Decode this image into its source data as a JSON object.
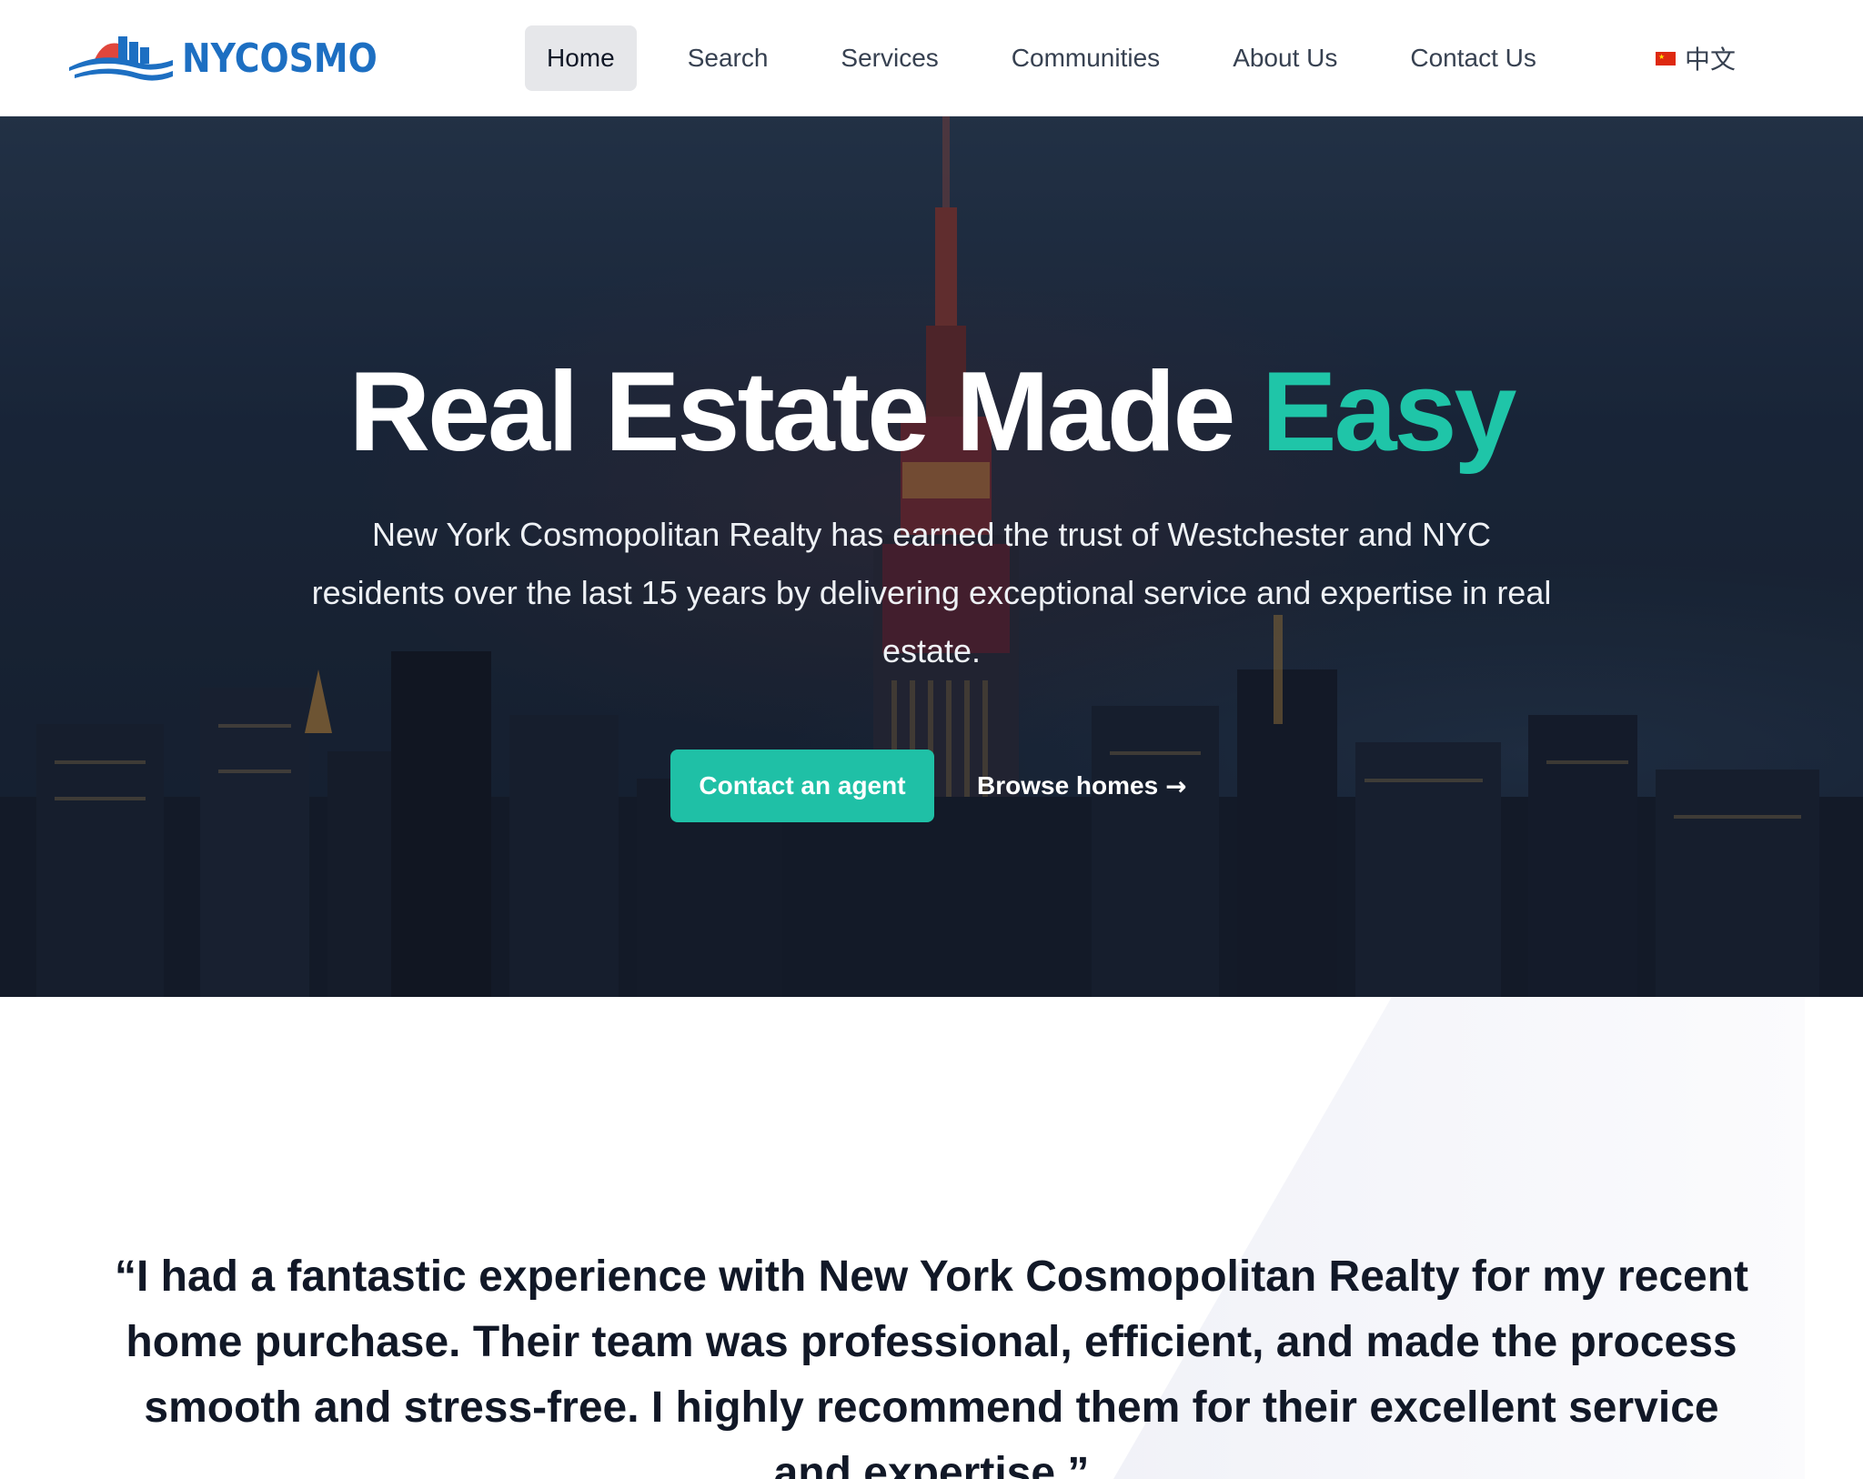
{
  "brand": {
    "name": "NYCOSMO",
    "logo_icon": "city-skyline-wave-icon",
    "colors": {
      "brand_blue": "#1d6fc2",
      "accent_teal": "#1fc5a8",
      "logo_red": "#e0463c"
    }
  },
  "nav": {
    "items": [
      {
        "label": "Home",
        "active": true
      },
      {
        "label": "Search",
        "active": false
      },
      {
        "label": "Services",
        "active": false
      },
      {
        "label": "Communities",
        "active": false
      },
      {
        "label": "About Us",
        "active": false
      },
      {
        "label": "Contact Us",
        "active": false
      }
    ],
    "language": {
      "icon": "china-flag-icon",
      "label": "中文"
    }
  },
  "hero": {
    "title_main": "Real Estate Made ",
    "title_accent": "Easy",
    "subtitle": "New York Cosmopolitan Realty has earned the trust of Westchester and NYC residents over the last 15 years by delivering exceptional service and expertise in real estate.",
    "primary_cta": "Contact an agent",
    "secondary_cta": "Browse homes",
    "secondary_cta_arrow": "→"
  },
  "testimonial": {
    "quote": "“I had a fantastic experience with New York Cosmopolitan Realty for my recent home purchase. Their team was professional, efficient, and made the process smooth and stress-free. I highly recommend them for their excellent service and expertise.”"
  }
}
